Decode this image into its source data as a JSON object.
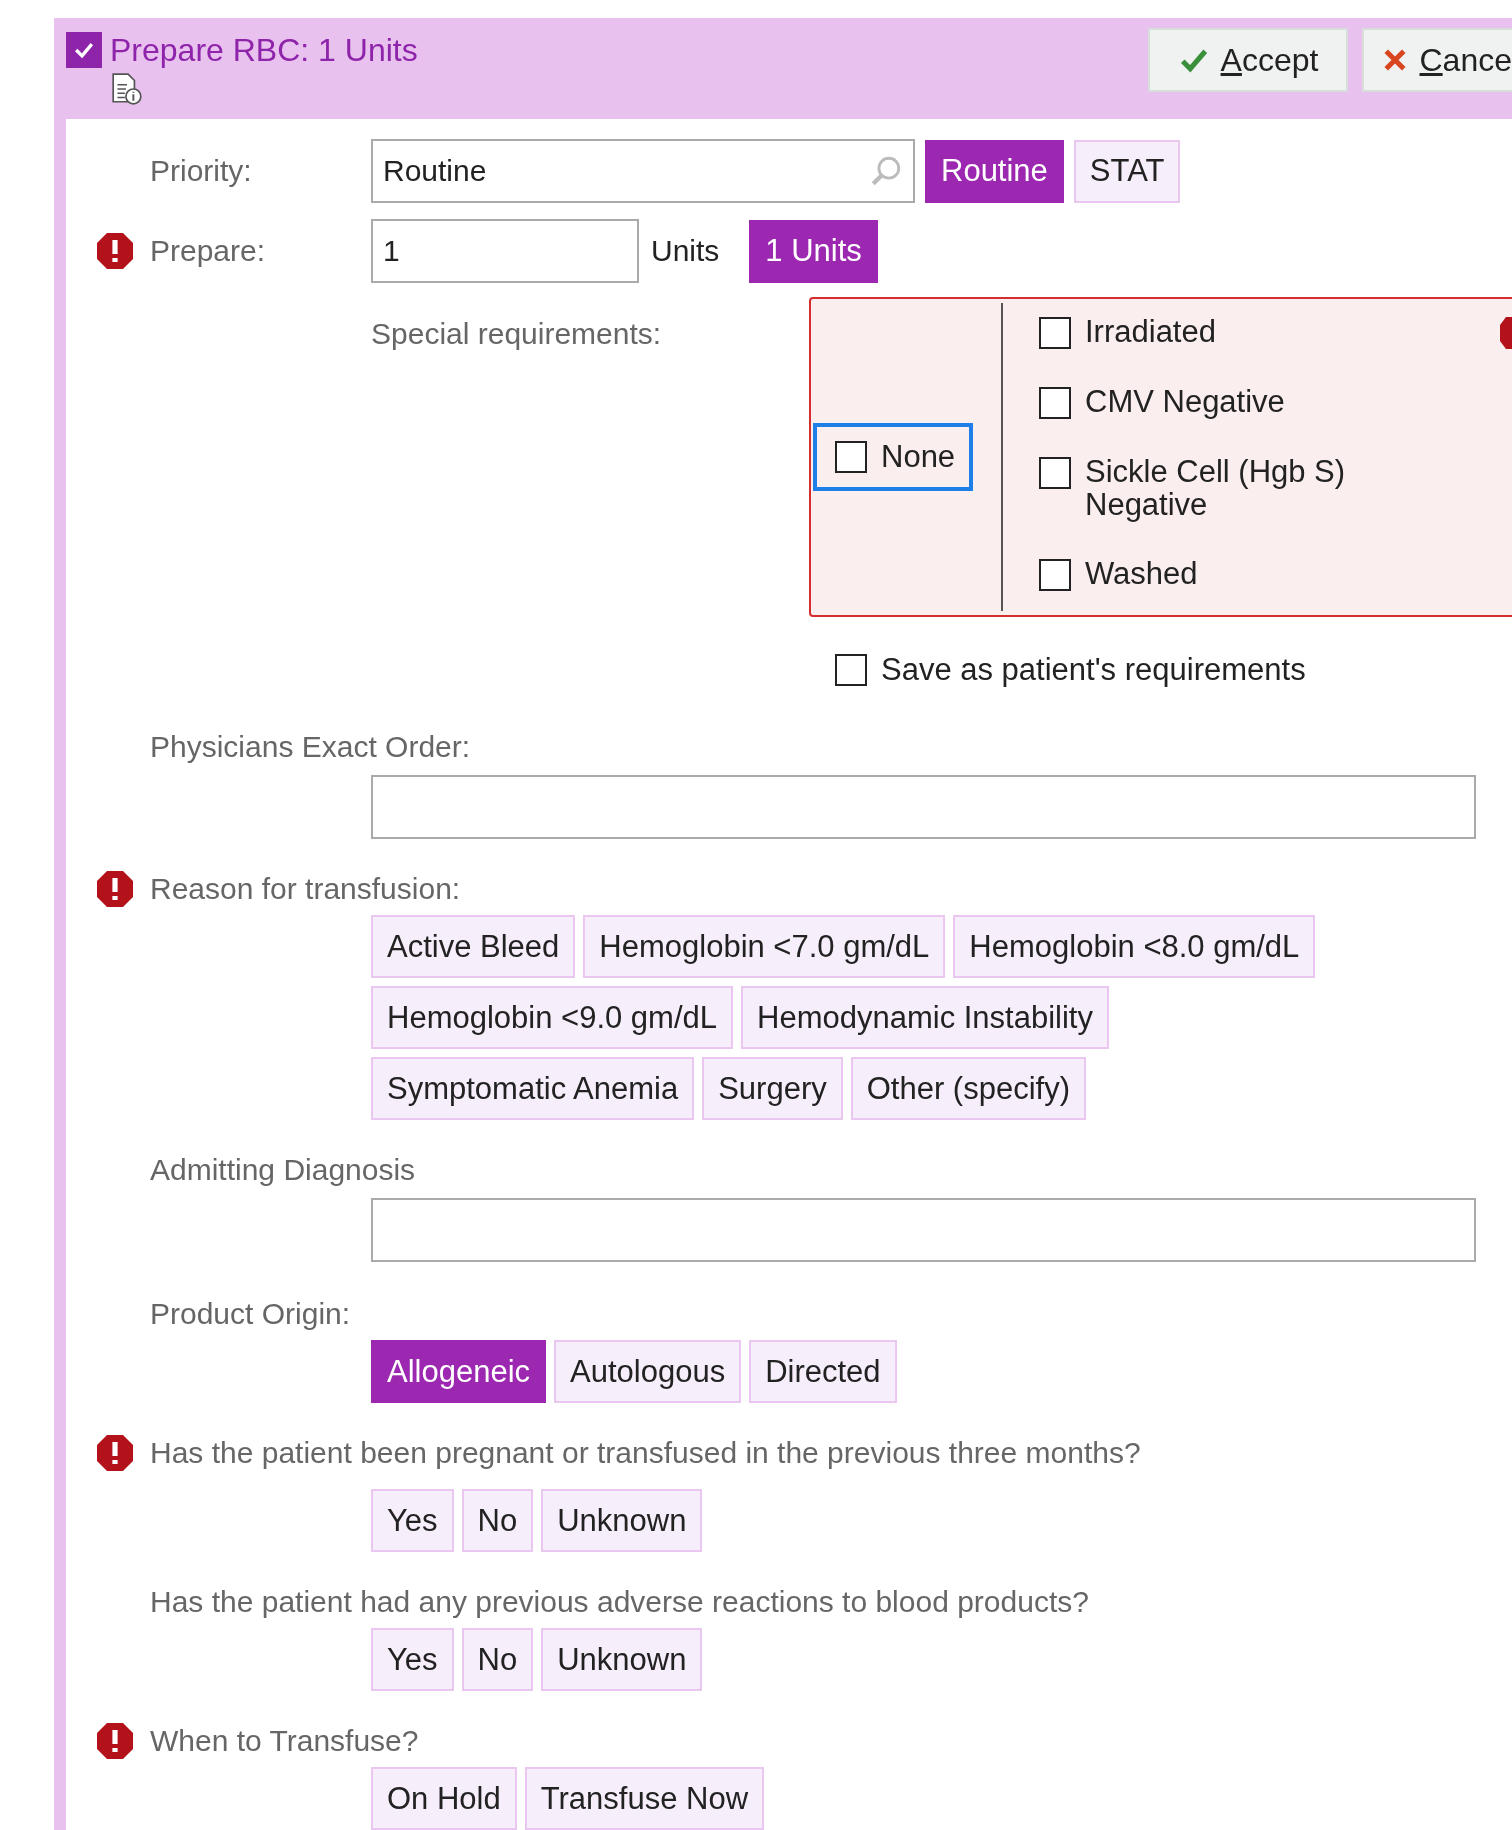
{
  "order": {
    "checked": true,
    "title": "Prepare RBC: 1 Units"
  },
  "actions": [
    {
      "label": "Accept",
      "kind": "accept"
    },
    {
      "label": "Cance",
      "kind": "cancel"
    }
  ],
  "priority": {
    "label": "Priority:",
    "required": false,
    "value": "Routine",
    "options": [
      {
        "label": "Routine",
        "selected": true
      },
      {
        "label": "STAT",
        "selected": false
      }
    ]
  },
  "prepare": {
    "label": "Prepare:",
    "required": true,
    "value": "1",
    "unit": "Units",
    "options": [
      {
        "label": "1 Units",
        "selected": true
      }
    ]
  },
  "special_requirements": {
    "label": "Special requirements:",
    "error": true,
    "none": {
      "label": "None",
      "checked": false,
      "focused": true
    },
    "items": [
      {
        "label": "Irradiated",
        "checked": false
      },
      {
        "label": "CMV Negative",
        "checked": false
      },
      {
        "label": "Sickle Cell (Hgb S) Negative",
        "checked": false
      },
      {
        "label": "Washed",
        "checked": false
      }
    ],
    "save": {
      "label": "Save as patient's requirements",
      "checked": false
    }
  },
  "physicians_exact_order": {
    "label": "Physicians Exact Order:",
    "required": false
  },
  "reason_for_transfusion": {
    "label": "Reason for transfusion:",
    "required": true,
    "options": [
      {
        "label": "Active Bleed",
        "selected": false
      },
      {
        "label": "Hemoglobin <7.0 gm/dL",
        "selected": false
      },
      {
        "label": "Hemoglobin <8.0 gm/dL",
        "selected": false
      },
      {
        "label": "Hemoglobin <9.0 gm/dL",
        "selected": false
      },
      {
        "label": "Hemodynamic Instability",
        "selected": false
      },
      {
        "label": "Symptomatic Anemia",
        "selected": false
      },
      {
        "label": "Surgery",
        "selected": false
      },
      {
        "label": "Other (specify)",
        "selected": false
      }
    ]
  },
  "admitting_diagnosis": {
    "label": "Admitting Diagnosis",
    "required": false
  },
  "product_origin": {
    "label": "Product Origin:",
    "required": false,
    "options": [
      {
        "label": "Allogeneic",
        "selected": true
      },
      {
        "label": "Autologous",
        "selected": false
      },
      {
        "label": "Directed",
        "selected": false
      }
    ]
  },
  "pregnant_or_transfused": {
    "label": "Has the patient been pregnant or transfused in the previous three months?",
    "required": true,
    "options": [
      {
        "label": "Yes",
        "selected": false
      },
      {
        "label": "No",
        "selected": false
      },
      {
        "label": "Unknown",
        "selected": false
      }
    ]
  },
  "adverse_reactions": {
    "label": "Has the patient had any previous adverse reactions to blood products?",
    "required": false,
    "options": [
      {
        "label": "Yes",
        "selected": false
      },
      {
        "label": "No",
        "selected": false
      },
      {
        "label": "Unknown",
        "selected": false
      }
    ]
  },
  "when_to_transfuse": {
    "label": "When to Transfuse?",
    "required": true,
    "options": [
      {
        "label": "On Hold",
        "selected": false
      },
      {
        "label": "Transfuse Now",
        "selected": false
      }
    ]
  }
}
